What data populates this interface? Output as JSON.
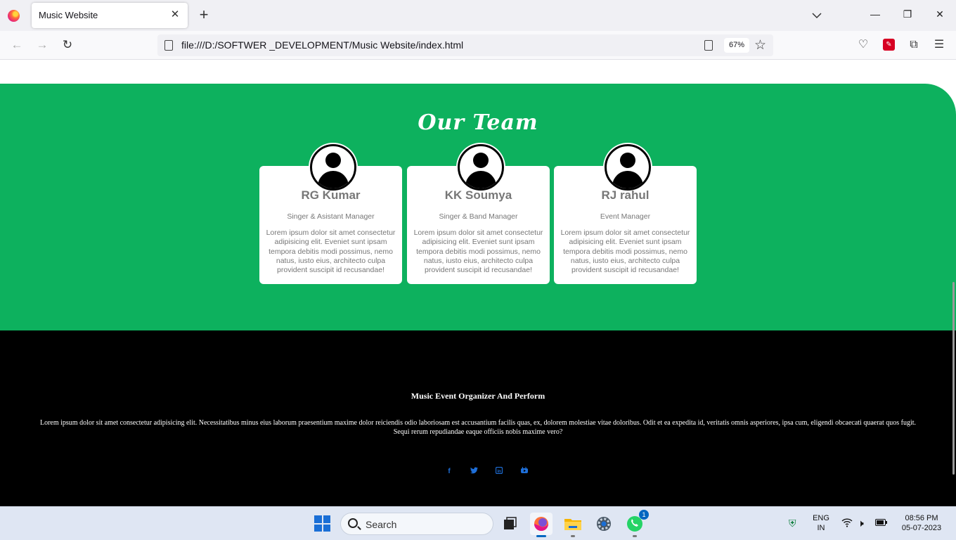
{
  "browser": {
    "tab_title": "Music Website",
    "url": "file:///D:/SOFTWER _DEVELOPMENT/Music Website/index.html",
    "zoom": "67%"
  },
  "team": {
    "title": "Our Team",
    "members": [
      {
        "name": "RG Kumar",
        "role": "Singer & Asistant Manager",
        "description": "Lorem ipsum dolor sit amet consectetur adipisicing elit. Eveniet sunt ipsam tempora debitis modi possimus, nemo natus, iusto eius, architecto culpa provident suscipit id recusandae!"
      },
      {
        "name": "KK Soumya",
        "role": "Singer & Band Manager",
        "description": "Lorem ipsum dolor sit amet consectetur adipisicing elit. Eveniet sunt ipsam tempora debitis modi possimus, nemo natus, iusto eius, architecto culpa provident suscipit id recusandae!"
      },
      {
        "name": "RJ rahul",
        "role": "Event Manager",
        "description": "Lorem ipsum dolor sit amet consectetur adipisicing elit. Eveniet sunt ipsam tempora debitis modi possimus, nemo natus, iusto eius, architecto culpa provident suscipit id recusandae!"
      }
    ]
  },
  "footer": {
    "title": "Music Event Organizer And Perform",
    "text": "Lorem ipsum dolor sit amet consectetur adipisicing elit. Necessitatibus minus eius laborum praesentium maxime dolor reiciendis odio laboriosam est accusantium facilis quas, ex, dolorem molestiae vitae doloribus. Odit et ea expedita id, veritatis omnis asperiores, ipsa cum, eligendi obcaecati quaerat quos fugit. Sequi rerum repudiandae eaque officiis nobis maxime vero?",
    "social_icons": [
      "facebook-icon",
      "twitter-icon",
      "linkedin-icon",
      "youtube-icon"
    ]
  },
  "taskbar": {
    "search_placeholder": "Search",
    "whatsapp_badge": "1",
    "language_line1": "ENG",
    "language_line2": "IN",
    "time": "08:56 PM",
    "date": "05-07-2023"
  },
  "colors": {
    "team_background": "#0db15e",
    "footer_background": "#000000",
    "social_icon": "#1e6fd9"
  }
}
